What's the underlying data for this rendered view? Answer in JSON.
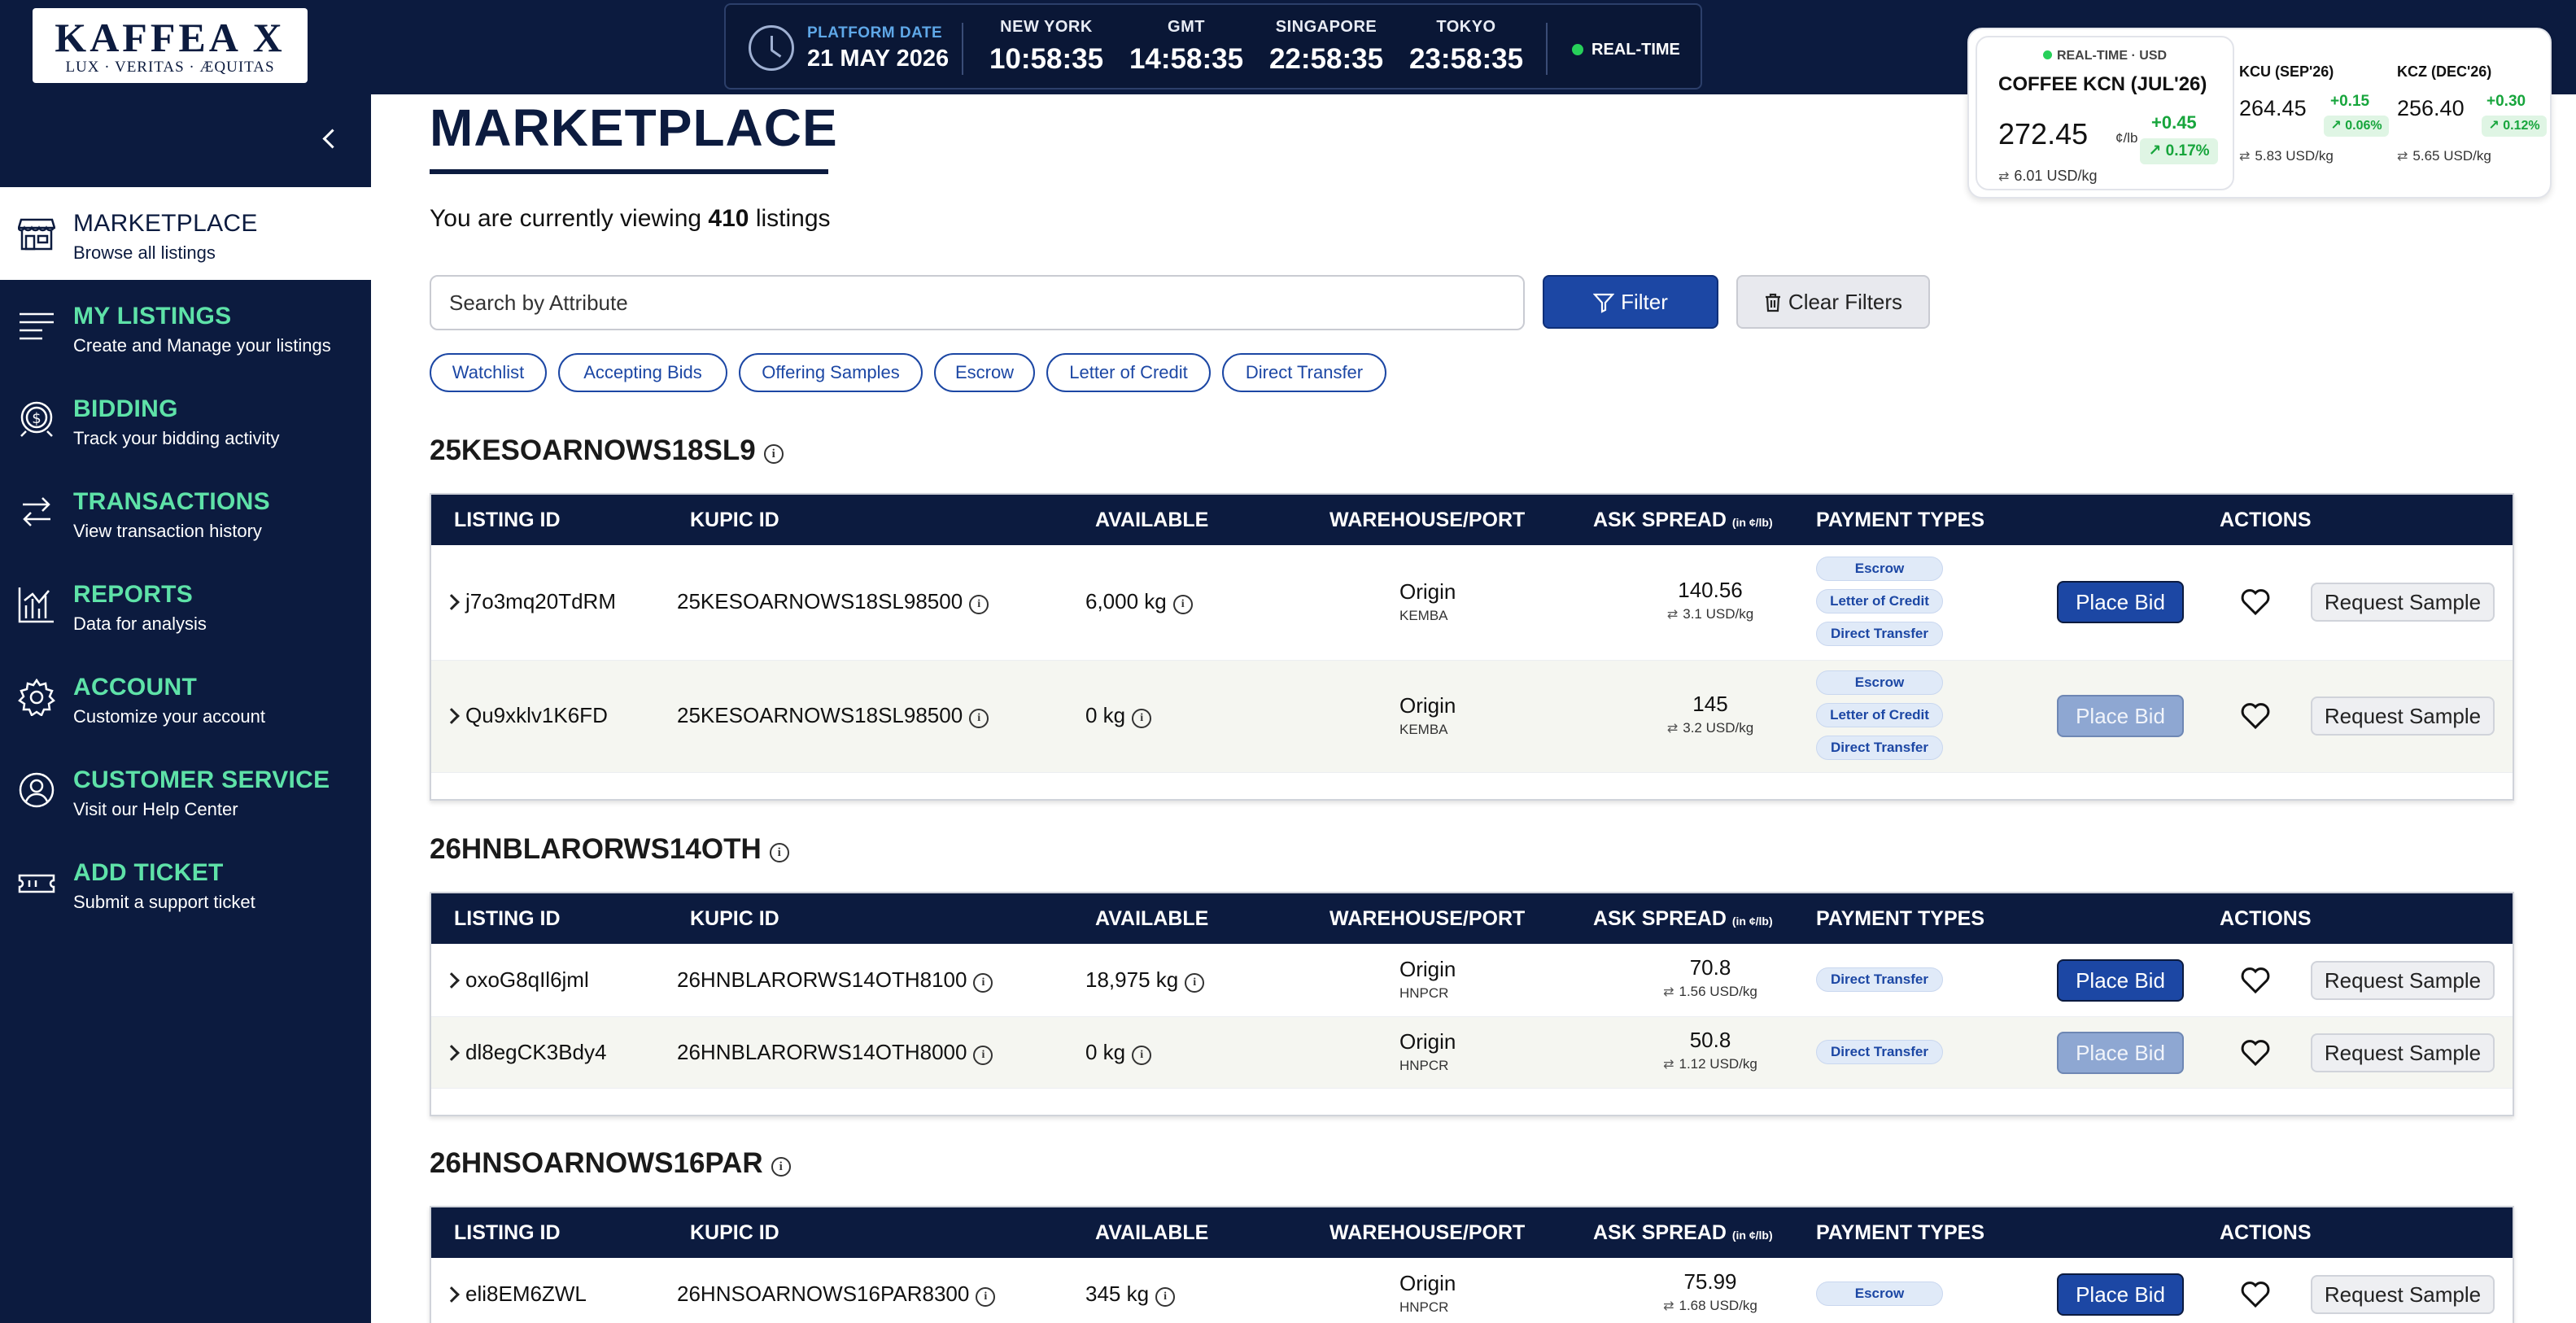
{
  "logo": {
    "brand": "KAFFEA X",
    "motto": "LUX · VERITAS · ÆQUITAS"
  },
  "clock": {
    "platform_label": "PLATFORM DATE",
    "platform_date": "21 MAY 2026",
    "zones": [
      {
        "name": "NEW YORK",
        "time": "10:58:35"
      },
      {
        "name": "GMT",
        "time": "14:58:35"
      },
      {
        "name": "SINGAPORE",
        "time": "22:58:35"
      },
      {
        "name": "TOKYO",
        "time": "23:58:35"
      }
    ],
    "realtime_label": "REAL-TIME"
  },
  "ticker": {
    "main": {
      "realtime_label": "REAL-TIME · USD",
      "title": "COFFEE KCN (JUL'26)",
      "price": "272.45",
      "unit": "¢/lb",
      "change": "+0.45",
      "pct": "↗ 0.17%",
      "conversion": "6.01 USD/kg"
    },
    "others": [
      {
        "title": "KCU (SEP'26)",
        "price": "264.45",
        "change": "+0.15",
        "pct": "↗ 0.06%",
        "conversion": "5.83 USD/kg"
      },
      {
        "title": "KCZ (DEC'26)",
        "price": "256.40",
        "change": "+0.30",
        "pct": "↗ 0.12%",
        "conversion": "5.65 USD/kg"
      }
    ],
    "accent_green": "#17a53c"
  },
  "sidebar": {
    "items": [
      {
        "title": "MARKETPLACE",
        "sub": "Browse all listings",
        "icon": "storefront-icon",
        "active": true
      },
      {
        "title": "MY LISTINGS",
        "sub": "Create and Manage your listings",
        "icon": "list-icon"
      },
      {
        "title": "BIDDING",
        "sub": "Track your bidding activity",
        "icon": "dollar-coin-icon"
      },
      {
        "title": "TRANSACTIONS",
        "sub": "View transaction history",
        "icon": "swap-arrows-icon"
      },
      {
        "title": "REPORTS",
        "sub": "Data for analysis",
        "icon": "chart-icon"
      },
      {
        "title": "ACCOUNT",
        "sub": "Customize your account",
        "icon": "gear-icon"
      },
      {
        "title": "CUSTOMER SERVICE",
        "sub": "Visit our Help Center",
        "icon": "user-circle-icon"
      },
      {
        "title": "ADD TICKET",
        "sub": "Submit a support ticket",
        "icon": "ticket-icon"
      }
    ],
    "accent": "#5ee2a8",
    "background": "#0c1b3f"
  },
  "main": {
    "title": "MARKETPLACE",
    "viewing_prefix": "You are currently viewing",
    "viewing_count": "410",
    "viewing_suffix": "listings",
    "search_placeholder": "Search by Attribute",
    "filter_label": "Filter",
    "clear_label": "Clear Filters",
    "chips": [
      "Watchlist",
      "Accepting Bids",
      "Offering Samples",
      "Escrow",
      "Letter of Credit",
      "Direct Transfer"
    ],
    "columns": {
      "listing_id": "LISTING ID",
      "kupic_id": "KUPIC ID",
      "available": "AVAILABLE",
      "warehouse": "WAREHOUSE/PORT",
      "ask": "ASK SPREAD",
      "ask_unit": "(in ¢/lb)",
      "payment": "PAYMENT TYPES",
      "actions": "ACTIONS"
    },
    "place_bid_label": "Place Bid",
    "request_sample_label": "Request Sample",
    "groups": [
      {
        "title": "25KESOARNOWS18SL9",
        "rows": [
          {
            "listing_id": "j7o3mq20TdRM",
            "kupic": "25KESOARNOWS18SL98500",
            "available": "6,000 kg",
            "warehouse": "Origin",
            "port": "KEMBA",
            "ask": "140.56",
            "ask_conv": "3.1 USD/kg",
            "payments": [
              "Escrow",
              "Letter of Credit",
              "Direct Transfer"
            ],
            "bid_enabled": true
          },
          {
            "listing_id": "Qu9xklv1K6FD",
            "kupic": "25KESOARNOWS18SL98500",
            "available": "0 kg",
            "warehouse": "Origin",
            "port": "KEMBA",
            "ask": "145",
            "ask_conv": "3.2 USD/kg",
            "payments": [
              "Escrow",
              "Letter of Credit",
              "Direct Transfer"
            ],
            "bid_enabled": false
          }
        ]
      },
      {
        "title": "26HNBLARORWS14OTH",
        "rows": [
          {
            "listing_id": "oxoG8qIl6jml",
            "kupic": "26HNBLARORWS14OTH8100",
            "available": "18,975 kg",
            "warehouse": "Origin",
            "port": "HNPCR",
            "ask": "70.8",
            "ask_conv": "1.56 USD/kg",
            "payments": [
              "Direct Transfer"
            ],
            "bid_enabled": true
          },
          {
            "listing_id": "dl8egCK3Bdy4",
            "kupic": "26HNBLARORWS14OTH8000",
            "available": "0 kg",
            "warehouse": "Origin",
            "port": "HNPCR",
            "ask": "50.8",
            "ask_conv": "1.12 USD/kg",
            "payments": [
              "Direct Transfer"
            ],
            "bid_enabled": false
          }
        ]
      },
      {
        "title": "26HNSOARNOWS16PAR",
        "rows": [
          {
            "listing_id": "eli8EM6ZWL",
            "kupic": "26HNSOARNOWS16PAR8300",
            "available": "345 kg",
            "warehouse": "Origin",
            "port": "HNPCR",
            "ask": "75.99",
            "ask_conv": "1.68 USD/kg",
            "payments": [
              "Escrow"
            ],
            "bid_enabled": true
          }
        ]
      }
    ]
  }
}
